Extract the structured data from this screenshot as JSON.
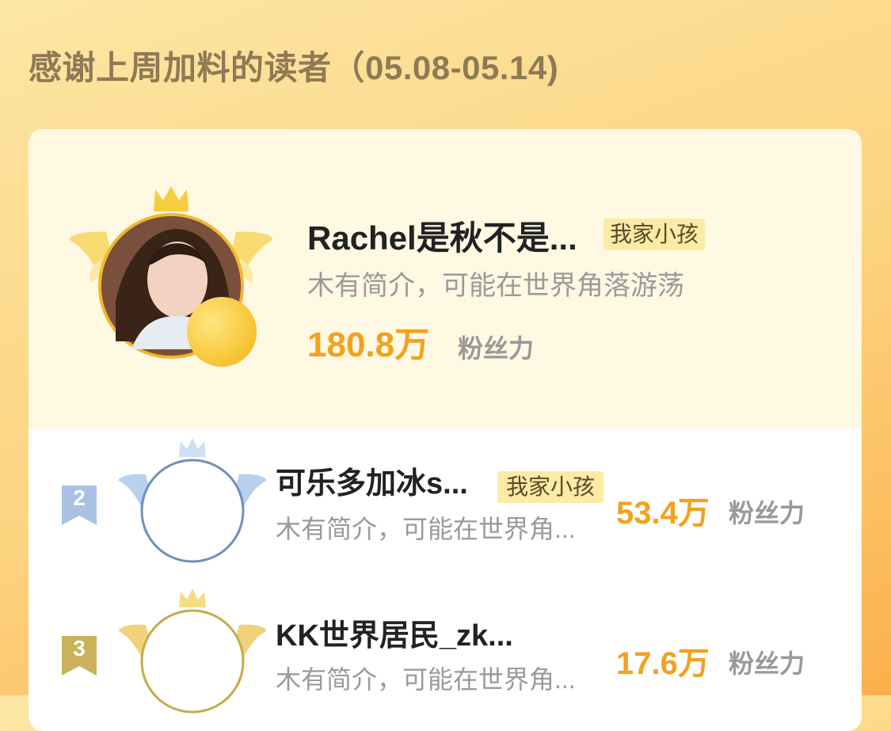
{
  "header": {
    "title": "感谢上周加料的读者（05.08-05.14)"
  },
  "ranking": [
    {
      "rank": "1",
      "name": "Rachel是秋不是...",
      "tag": "我家小孩",
      "description": "木有简介，可能在世界角落游荡",
      "fans_value": "180.8万",
      "fans_label": "粉丝力",
      "badge_icon": "gold-wings-crown-icon",
      "avatar_icon": "avatar-photo"
    },
    {
      "rank": "2",
      "name": "可乐多加冰s...",
      "tag": "我家小孩",
      "description": "木有简介，可能在世界角...",
      "fans_value": "53.4万",
      "fans_label": "粉丝力",
      "badge_icon": "silver-wings-crown-icon"
    },
    {
      "rank": "3",
      "name": "KK世界居民_zk...",
      "tag": "",
      "description": "木有简介，可能在世界角...",
      "fans_value": "17.6万",
      "fans_label": "粉丝力",
      "badge_icon": "bronze-wings-crown-icon"
    }
  ],
  "colors": {
    "accent": "#f4a11c",
    "tag_bg": "#fdeaa5",
    "silver": "#7f9cc4",
    "bronze": "#c9a94a"
  }
}
